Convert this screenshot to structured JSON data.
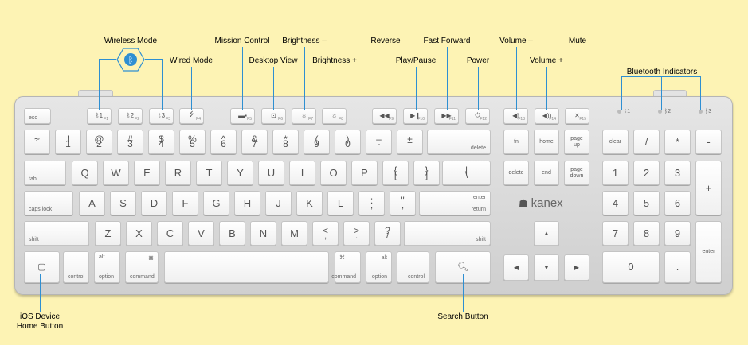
{
  "callouts": {
    "wireless_mode": "Wireless Mode",
    "wired_mode": "Wired Mode",
    "mission_control": "Mission Control",
    "desktop_view": "Desktop View",
    "brightness_down": "Brightness –",
    "brightness_up": "Brightness +",
    "reverse": "Reverse",
    "play_pause": "Play/Pause",
    "fast_forward": "Fast Forward",
    "power": "Power",
    "volume_down": "Volume –",
    "volume_up": "Volume +",
    "mute": "Mute",
    "bluetooth_indicators": "Bluetooth Indicators",
    "ios_home_line1": "iOS Device",
    "ios_home_line2": "Home Button",
    "search_button": "Search Button"
  },
  "logo": {
    "text": "kanex",
    "mark": "☗"
  },
  "bluetooth_badge": "ᛒ",
  "indicators": [
    "ᛒ1",
    "ᛒ2",
    "ᛒ3"
  ],
  "fn_row": [
    {
      "type": "text",
      "a": "esc"
    },
    {
      "type": "icon",
      "a": "ᛒ1",
      "f": "F1"
    },
    {
      "type": "icon",
      "a": "ᛒ2",
      "f": "F2"
    },
    {
      "type": "icon",
      "a": "ᛒ3",
      "f": "F3"
    },
    {
      "type": "icon",
      "a": "⭍",
      "f": "F4"
    },
    {
      "type": "icon",
      "a": "▬▪",
      "f": "F5"
    },
    {
      "type": "icon",
      "a": "⊡",
      "f": "F6"
    },
    {
      "type": "icon",
      "a": "☼",
      "f": "F7"
    },
    {
      "type": "icon",
      "a": "☼",
      "f": "F8"
    },
    {
      "type": "icon",
      "a": "◀◀",
      "f": "F9"
    },
    {
      "type": "icon",
      "a": "▶❙",
      "f": "F10"
    },
    {
      "type": "icon",
      "a": "▶▶",
      "f": "F11"
    },
    {
      "type": "icon",
      "a": "⏻",
      "f": "F12"
    },
    {
      "type": "icon",
      "a": "◀)",
      "f": "F13"
    },
    {
      "type": "icon",
      "a": "◀))",
      "f": "F14"
    },
    {
      "type": "icon",
      "a": "✕",
      "f": "F15"
    }
  ],
  "number_row": [
    {
      "t": "~",
      "b": "`"
    },
    {
      "t": "!",
      "b": "1"
    },
    {
      "t": "@",
      "b": "2"
    },
    {
      "t": "#",
      "b": "3"
    },
    {
      "t": "$",
      "b": "4"
    },
    {
      "t": "%",
      "b": "5"
    },
    {
      "t": "^",
      "b": "6"
    },
    {
      "t": "&",
      "b": "7"
    },
    {
      "t": "*",
      "b": "8"
    },
    {
      "t": "(",
      "b": "9"
    },
    {
      "t": ")",
      "b": "0"
    },
    {
      "t": "–",
      "b": "-"
    },
    {
      "t": "+",
      "b": "="
    },
    {
      "br": "delete"
    }
  ],
  "top_row": [
    {
      "bl": "tab"
    },
    {
      "m": "Q"
    },
    {
      "m": "W"
    },
    {
      "m": "E"
    },
    {
      "m": "R"
    },
    {
      "m": "T"
    },
    {
      "m": "Y"
    },
    {
      "m": "U"
    },
    {
      "m": "I"
    },
    {
      "m": "O"
    },
    {
      "m": "P"
    },
    {
      "t": "{",
      "b": "["
    },
    {
      "t": "}",
      "b": "]"
    },
    {
      "t": "|",
      "b": "\\"
    }
  ],
  "home_row": [
    {
      "bl": "caps lock"
    },
    {
      "m": "A"
    },
    {
      "m": "S"
    },
    {
      "m": "D"
    },
    {
      "m": "F"
    },
    {
      "m": "G"
    },
    {
      "m": "H"
    },
    {
      "m": "J"
    },
    {
      "m": "K"
    },
    {
      "m": "L"
    },
    {
      "t": ":",
      "b": ";"
    },
    {
      "t": "\"",
      "b": ","
    },
    {
      "tr": "enter",
      "br": "return"
    }
  ],
  "bottom_row": [
    {
      "bl": "shift"
    },
    {
      "m": "Z"
    },
    {
      "m": "X"
    },
    {
      "m": "C"
    },
    {
      "m": "V"
    },
    {
      "m": "B"
    },
    {
      "m": "N"
    },
    {
      "m": "M"
    },
    {
      "t": "<",
      "b": ","
    },
    {
      "t": ">",
      "b": "."
    },
    {
      "t": "?",
      "b": "/"
    },
    {
      "br": "shift"
    }
  ],
  "space_row": [
    {
      "ico": "▢"
    },
    {
      "bl": "control"
    },
    {
      "tl": "alt",
      "bl": "option"
    },
    {
      "tr": "⌘",
      "bl": "command"
    },
    {
      "m": ""
    },
    {
      "tl": "⌘",
      "br": "command"
    },
    {
      "tr": "alt",
      "br": "option"
    },
    {
      "br": "control"
    },
    {
      "ico": "🔍︎"
    }
  ],
  "nav_keys": [
    {
      "t2": "fn"
    },
    {
      "t2": "home"
    },
    {
      "t2": "page\nup"
    },
    {
      "t2": "delete"
    },
    {
      "t2": "end"
    },
    {
      "t2": "page\ndown"
    }
  ],
  "arrows": {
    "up": "▲",
    "left": "◀",
    "down": "▼",
    "right": "▶"
  },
  "numpad": [
    {
      "t2": "clear"
    },
    {
      "m": "/"
    },
    {
      "m": "*"
    },
    {
      "m": "-"
    },
    {
      "m": "7"
    },
    {
      "m": "8"
    },
    {
      "m": "9"
    },
    {
      "m": "+"
    },
    {
      "m": "4"
    },
    {
      "m": "5"
    },
    {
      "m": "6"
    },
    {
      "m": "1"
    },
    {
      "m": "2"
    },
    {
      "m": "3"
    },
    {
      "t2": "enter"
    },
    {
      "m": "0"
    },
    {
      "m": "."
    }
  ],
  "colors": {
    "background": "#fdf3b4",
    "callout_line": "#2e8fd2",
    "key_text": "#555555"
  }
}
